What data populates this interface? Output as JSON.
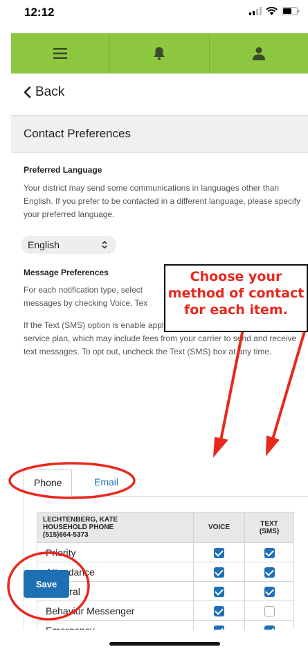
{
  "status": {
    "time": "12:12"
  },
  "nav": {
    "items": [
      "menu-icon",
      "bell-icon",
      "user-icon"
    ]
  },
  "back": {
    "label": "Back"
  },
  "section": {
    "title": "Contact Preferences"
  },
  "language": {
    "heading": "Preferred Language",
    "description": "Your district may send some communications in languages other than English. If you prefer to be contacted in a different language, please specify your preferred language.",
    "selected": "English"
  },
  "messages": {
    "heading": "Message Preferences",
    "desc1": "For each notification type, select messages by checking Voice, Tex",
    "desc2": "If the Text (SMS) option is enable apply. Charges are dependent on your service plan, which may include fees from your carrier to send and receive text messages. To opt out, uncheck the Text (SMS) box at any time."
  },
  "tabs": {
    "phone": "Phone",
    "email": "Email"
  },
  "table": {
    "contact_name": "LECHTENBERG, KATE",
    "contact_type": "HOUSEHOLD PHONE",
    "contact_number": "(515)664-5373",
    "col_voice": "VOICE",
    "col_text": "TEXT (SMS)",
    "rows": [
      {
        "label": "Priority",
        "voice": true,
        "text": true
      },
      {
        "label": "Attendance",
        "voice": true,
        "text": true
      },
      {
        "label": "General",
        "voice": true,
        "text": true
      },
      {
        "label": "Behavior Messenger",
        "voice": true,
        "text": false
      },
      {
        "label": "Emergency",
        "voice": true,
        "text": true
      }
    ]
  },
  "save": {
    "label": "Save"
  },
  "annotation": {
    "line1": "Choose your",
    "line2": "method of contact",
    "line3": "for each item."
  },
  "colors": {
    "nav": "#8dc63f",
    "accent": "#1f6fb5",
    "annotation": "#e8281d"
  }
}
